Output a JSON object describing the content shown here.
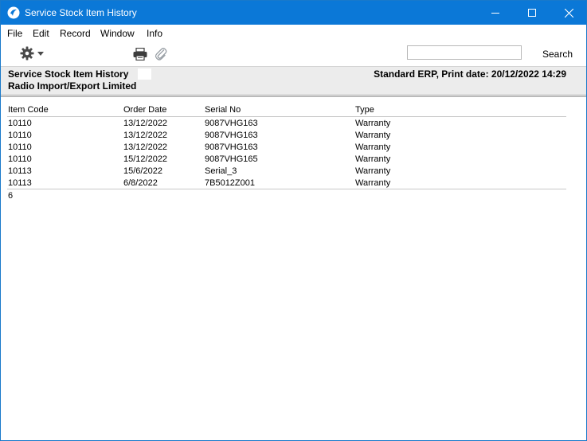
{
  "window": {
    "title": "Service Stock Item History"
  },
  "menu": [
    "File",
    "Edit",
    "Record",
    "Window",
    "Info"
  ],
  "toolbar": {
    "search_value": "",
    "search_label": "Search"
  },
  "header": {
    "title": "Service Stock Item History",
    "company": "Radio Import/Export Limited",
    "print_info": "Standard ERP, Print date: 20/12/2022 14:29"
  },
  "table": {
    "columns": [
      "Item Code",
      "Order Date",
      "Serial No",
      "Type"
    ],
    "rows": [
      [
        "10110",
        "13/12/2022",
        "9087VHG163",
        "Warranty"
      ],
      [
        "10110",
        "13/12/2022",
        "9087VHG163",
        "Warranty"
      ],
      [
        "10110",
        "13/12/2022",
        "9087VHG163",
        "Warranty"
      ],
      [
        "10110",
        "15/12/2022",
        "9087VHG165",
        "Warranty"
      ],
      [
        "10113",
        "15/6/2022",
        "Serial_3",
        "Warranty"
      ],
      [
        "10113",
        "6/8/2022",
        "7B5012Z001",
        "Warranty"
      ]
    ],
    "total_count": "6"
  },
  "colors": {
    "titlebar": "#0b78d7",
    "header_band": "#ececec"
  }
}
